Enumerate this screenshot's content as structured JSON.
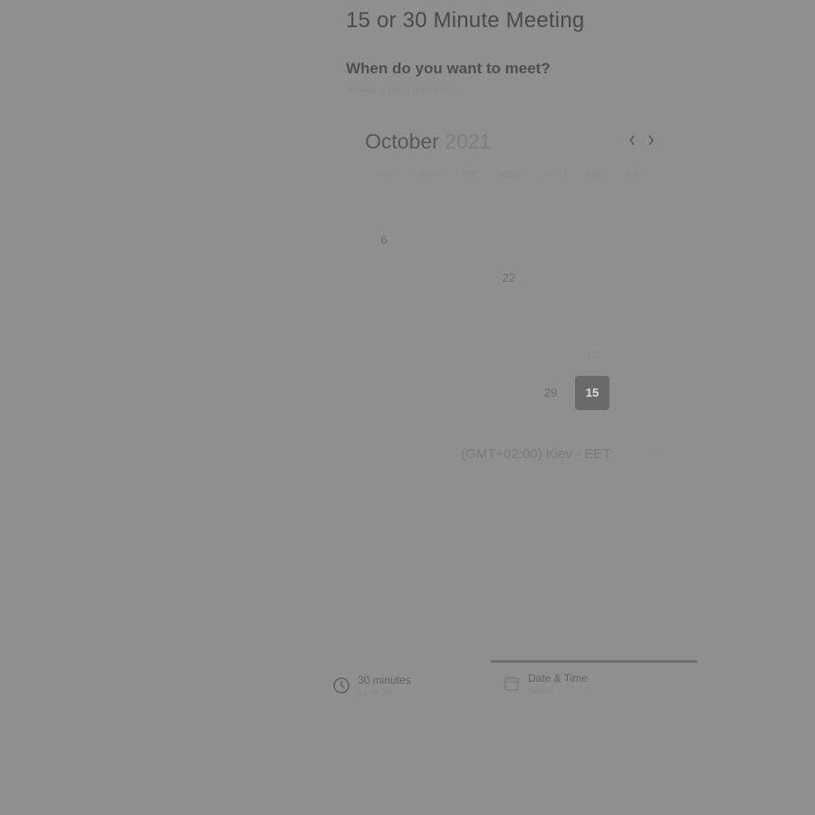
{
  "header": {
    "title": "15 or 30 Minute Meeting",
    "question": "When do you want to meet?",
    "subquestion": "Select a date and time"
  },
  "calendar": {
    "month": "October",
    "year": "2021",
    "prev_icon": "chevron-left-icon",
    "next_icon": "chevron-right-icon",
    "weekdays": [
      "SUN",
      "MON",
      "TUE",
      "WED",
      "THU",
      "FRI",
      "SAT"
    ],
    "visible_days": {
      "d6": "6",
      "d22": "22",
      "d10": "10",
      "d29": "29",
      "d15": "15"
    },
    "selected_day": "15"
  },
  "timezone": {
    "label": "(GMT+02:00) Kiev - EET",
    "icon": "chevron-down-icon"
  },
  "steps": {
    "duration": {
      "label": "30 minutes",
      "sub": "15 or 30",
      "icon": "clock-icon"
    },
    "datetime": {
      "label": "Date & Time",
      "sub": "Select",
      "icon": "calendar-icon"
    }
  },
  "colors": {
    "background": "#8f8f8f",
    "selected_day": "#6a6a6a",
    "progress": "#6f6f6f"
  }
}
